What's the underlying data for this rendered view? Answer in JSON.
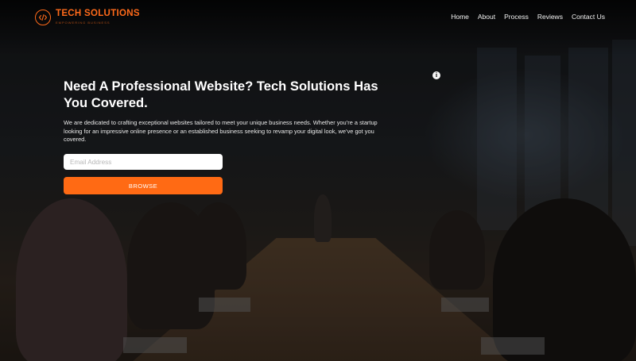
{
  "brand": {
    "title": "TECH SOLUTIONS",
    "tagline": "EMPOWERING BUSINESS",
    "logo_icon": "code-brackets-icon",
    "accent_color": "#ff6a1a"
  },
  "nav": {
    "items": [
      {
        "label": "Home"
      },
      {
        "label": "About"
      },
      {
        "label": "Process"
      },
      {
        "label": "Reviews"
      },
      {
        "label": "Contact Us"
      }
    ]
  },
  "hero": {
    "title": "Need A Professional Website? Tech Solutions Has You Covered.",
    "description": "We are dedicated to crafting exceptional websites tailored to meet your unique business needs. Whether you’re a startup looking for an impressive online presence or an established business seeking to revamp your digital look, we’ve got you covered.",
    "email_placeholder": "Email Address",
    "email_value": "",
    "button_label": "BROWSE",
    "button_color": "#ff6a14",
    "info_icon": "info-icon",
    "info_glyph": "i"
  }
}
